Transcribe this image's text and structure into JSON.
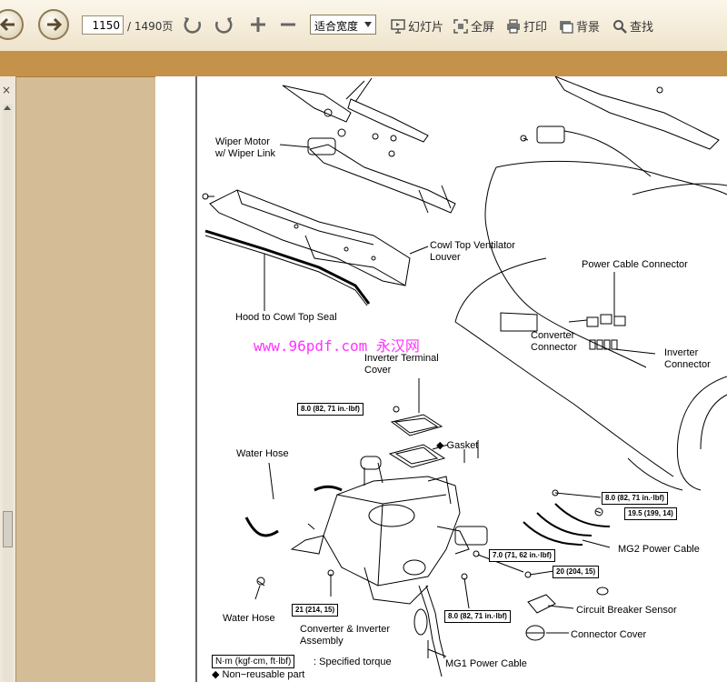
{
  "toolbar": {
    "page_current": "1150",
    "page_total": "/ 1490页",
    "zoom_value": "适合宽度",
    "slideshow_label": "幻灯片",
    "fullscreen_label": "全屏",
    "print_label": "打印",
    "background_label": "背景",
    "find_label": "查找"
  },
  "panel": {
    "close_glyph": "×"
  },
  "diagram": {
    "watermark": "www.96pdf.com 永汉网",
    "labels": {
      "wiper_motor": "Wiper Motor\nw/ Wiper Link",
      "cowl_louver": "Cowl Top Ventilator\nLouver",
      "hood_seal": "Hood to Cowl Top Seal",
      "power_cable_connector": "Power Cable Connector",
      "converter_connector": "Converter\nConnector",
      "inverter_connector": "Inverter\nConnector",
      "inverter_terminal_cover": "Inverter Terminal\nCover",
      "gasket": "◆ Gasket",
      "water_hose_top": "Water Hose",
      "water_hose_bottom": "Water Hose",
      "mg2_cable": "MG2 Power Cable",
      "circuit_breaker": "Circuit Breaker Sensor",
      "connector_cover": "Connector Cover",
      "converter_inverter": "Converter & Inverter\nAssembly",
      "mg1_cable": "MG1 Power Cable",
      "torque_unit": "N·m (kgf·cm, ft·lbf)",
      "specified_torque": ": Specified torque",
      "non_reusable": "◆ Non−reusable part"
    },
    "torques": {
      "t1": "8.0 (82, 71 in.·lbf)",
      "t2": "8.0 (82, 71 in.·lbf)",
      "t3": "19.5 (199, 14)",
      "t4": "7.0 (71, 62 in.·lbf)",
      "t5": "20 (204, 15)",
      "t6": "21 (214, 15)",
      "t7": "8.0 (82, 71 in.·lbf)"
    }
  }
}
